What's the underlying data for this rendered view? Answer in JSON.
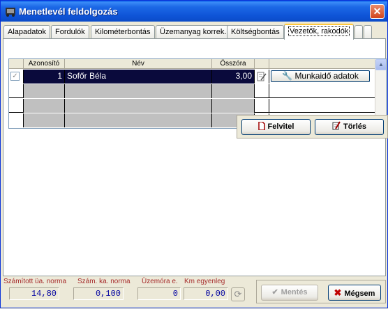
{
  "window": {
    "title": "Menetlevél feldolgozás",
    "close_label": "✕"
  },
  "tabs": [
    {
      "label": "Alapadatok"
    },
    {
      "label": "Fordulók"
    },
    {
      "label": "Kilométerbontás"
    },
    {
      "label": "Üzemanyag korrek."
    },
    {
      "label": "Költségbontás"
    },
    {
      "label": "Vezetők, rakodók"
    }
  ],
  "grid": {
    "columns": [
      "Azonosító",
      "Név",
      "Összóra"
    ],
    "rows": [
      {
        "id": "1",
        "name": "Sofőr Béla",
        "hours": "3,00",
        "checked": true
      }
    ],
    "work_button_label": "Munkaidő  adatok"
  },
  "actions": {
    "add_label": "Felvitel",
    "delete_label": "Törlés"
  },
  "footer": {
    "labels": {
      "calc_norm": "Számított üa. norma",
      "calc_ka_norm": "Szám. ka. norma",
      "engine_hours": "Üzemóra e.",
      "km_balance": "Km egyenleg"
    },
    "values": {
      "calc_norm": "14,80",
      "calc_ka_norm": "0,100",
      "engine_hours": "0",
      "km_balance": "0,00"
    },
    "save_label": "Mentés",
    "cancel_label": "Mégsem"
  }
}
